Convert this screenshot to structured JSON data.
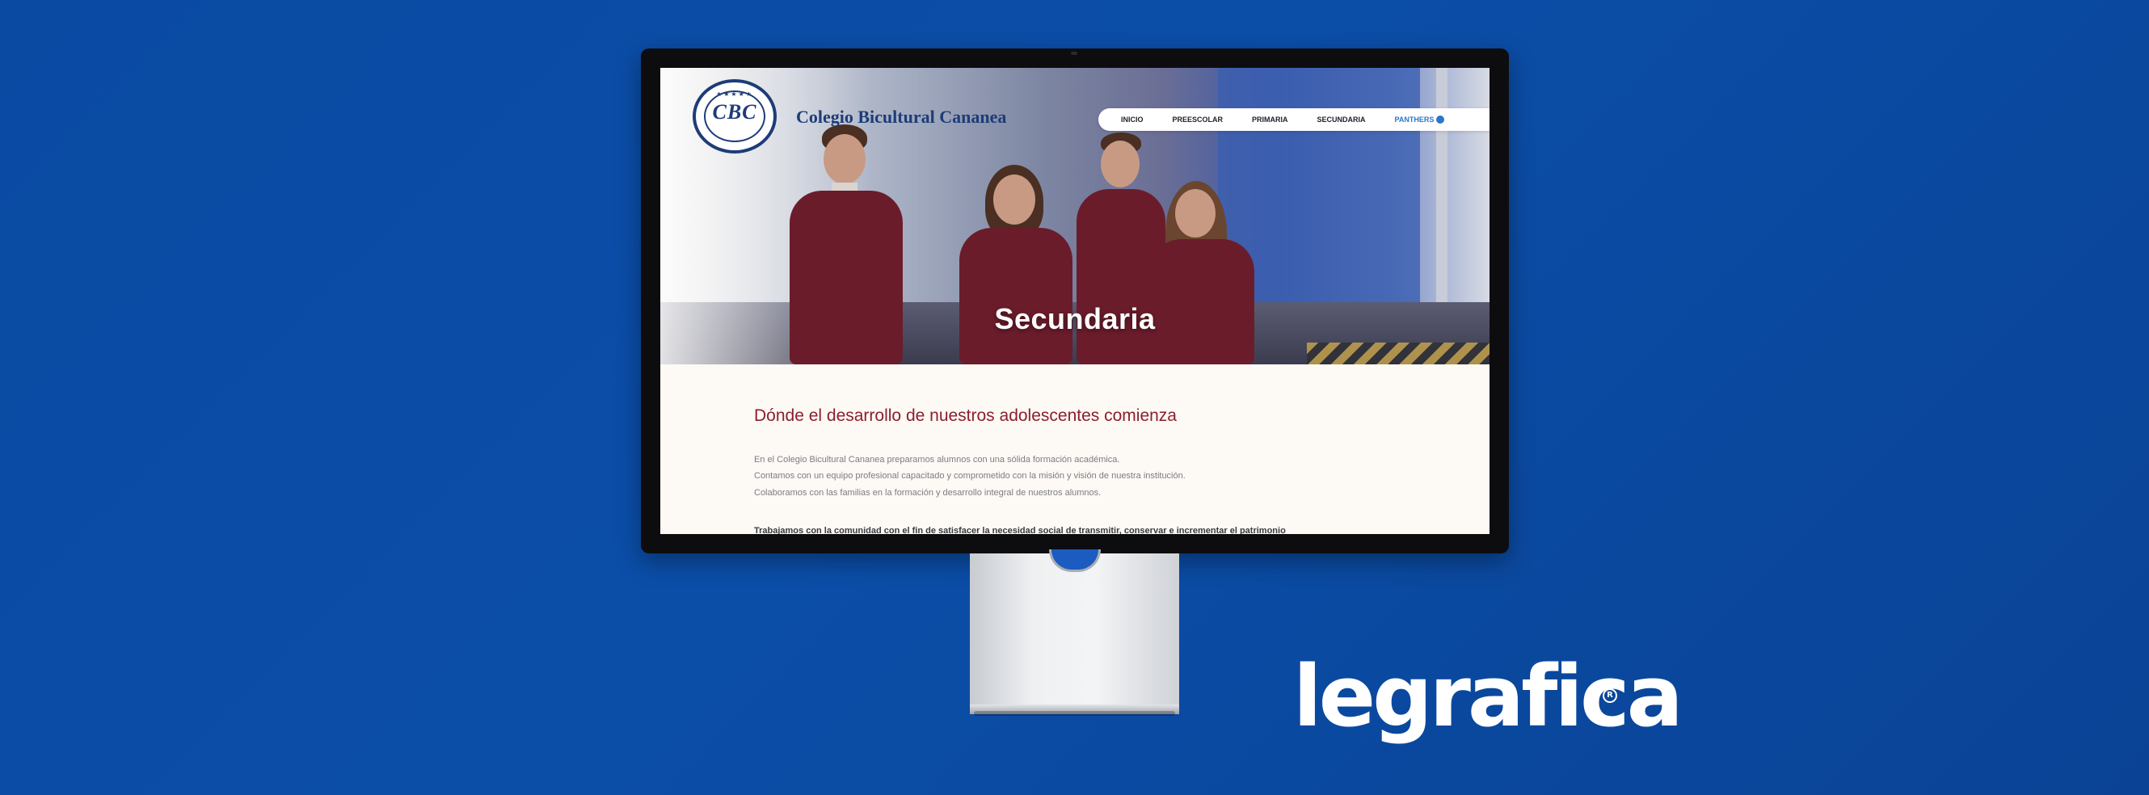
{
  "site": {
    "logo_text": "CBC",
    "logo_stars": "★★★★★",
    "school_name": "Colegio Bicultural Cananea",
    "nav": [
      {
        "label": "INICIO"
      },
      {
        "label": "PREESCOLAR"
      },
      {
        "label": "PRIMARIA"
      },
      {
        "label": "SECUNDARIA"
      },
      {
        "label": "PANTHERS"
      }
    ],
    "hero_title": "Secundaria",
    "section_heading": "Dónde el desarrollo de nuestros adolescentes comienza",
    "paragraphs": [
      "En el Colegio Bicultural Cananea preparamos alumnos con una sólida formación académica.",
      "Contamos con un equipo profesional capacitado y comprometido con la misión y visión de nuestra institución.",
      "Colaboramos con las familias en la formación y desarrollo integral de nuestros alumnos."
    ],
    "bold_line": "Trabajamos con la comunidad con el fin de satisfacer la necesidad social de transmitir, conservar e incrementar el patrimonio"
  },
  "brand": {
    "name": "legrafica",
    "registered": "R"
  },
  "colors": {
    "background": "#0b4ea8",
    "school_blue": "#1d3c78",
    "heading_red": "#8c1f2c",
    "panthers_blue": "#2a77c7"
  }
}
